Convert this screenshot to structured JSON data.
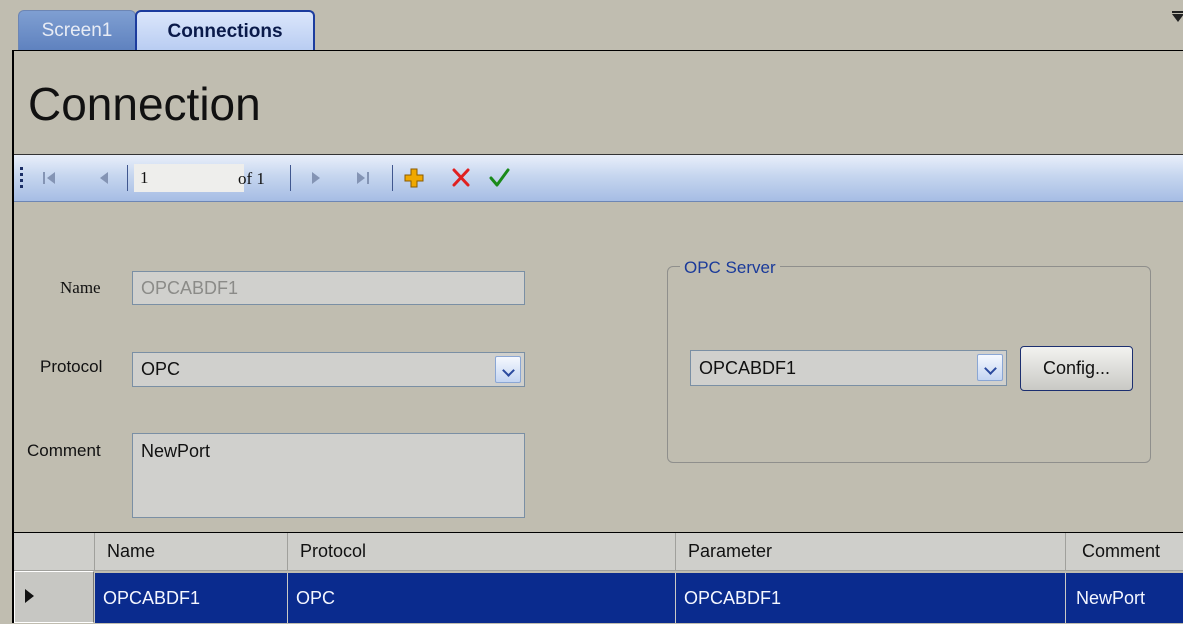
{
  "tabs": [
    {
      "label": "Screen1",
      "active": false
    },
    {
      "label": "Connections",
      "active": true
    }
  ],
  "page": {
    "title": "Connection"
  },
  "navigator": {
    "position": "1",
    "of_label": "of 1"
  },
  "form": {
    "name_label": "Name",
    "name_value": "OPCABDF1",
    "protocol_label": "Protocol",
    "protocol_value": "OPC",
    "comment_label": "Comment",
    "comment_value": "NewPort"
  },
  "opc_server": {
    "legend": "OPC Server",
    "server_value": "OPCABDF1",
    "config_label": "Config..."
  },
  "grid": {
    "columns": [
      "Name",
      "Protocol",
      "Parameter",
      "Comment"
    ],
    "rows": [
      {
        "name": "OPCABDF1",
        "protocol": "OPC",
        "parameter": "OPCABDF1",
        "comment": "NewPort",
        "selected": true
      }
    ]
  },
  "colors": {
    "background": "#c0bdb0",
    "selection": "#0a2b8e",
    "add_icon": "#f0a800",
    "delete_icon": "#e02020",
    "save_icon": "#1a8a1a"
  },
  "icons": [
    "move-first-icon",
    "move-previous-icon",
    "move-next-icon",
    "move-last-icon",
    "add-new-icon",
    "delete-icon",
    "save-icon",
    "chevron-down-icon",
    "row-pointer-icon"
  ]
}
